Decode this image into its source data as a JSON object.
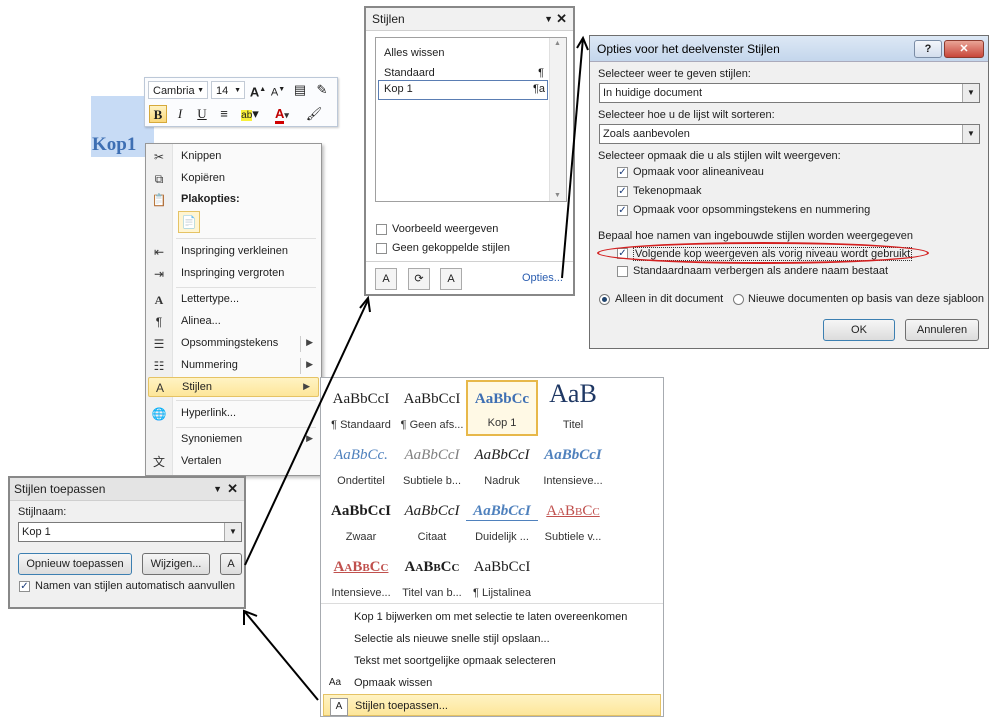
{
  "heading": {
    "text": "Kop1"
  },
  "mini_toolbar": {
    "font": "Cambria",
    "size": "14",
    "grow_label": "A",
    "shrink_label": "A",
    "bold": "B",
    "italic": "I",
    "underline": "U",
    "color_label": "A"
  },
  "context_menu": {
    "items": [
      {
        "label": "Knippen"
      },
      {
        "label": "Kopiëren"
      },
      {
        "label": "Plakopties:"
      },
      {
        "label": "Inspringing verkleinen"
      },
      {
        "label": "Inspringing vergroten"
      },
      {
        "label": "Lettertype..."
      },
      {
        "label": "Alinea..."
      },
      {
        "label": "Opsommingstekens"
      },
      {
        "label": "Nummering"
      },
      {
        "label": "Stijlen"
      },
      {
        "label": "Hyperlink..."
      },
      {
        "label": "Synoniemen"
      },
      {
        "label": "Vertalen"
      }
    ]
  },
  "styles_pane": {
    "title": "Stijlen",
    "items": [
      {
        "label": "Alles wissen",
        "mark": ""
      },
      {
        "label": "Standaard",
        "mark": "¶"
      },
      {
        "label": "Kop 1",
        "mark": "¶a"
      }
    ],
    "preview_label": "Voorbeeld weergeven",
    "linked_label": "Geen gekoppelde stijlen",
    "options_link": "Opties..."
  },
  "options_dialog": {
    "title": "Opties voor het deelvenster Stijlen",
    "help": "?",
    "close": "✕",
    "show_label": "Selecteer weer te geven stijlen:",
    "show_value": "In huidige document",
    "sort_label": "Selecteer hoe u de lijst wilt sorteren:",
    "sort_value": "Zoals aanbevolen",
    "format_label": "Selecteer opmaak die u als stijlen wilt weergeven:",
    "cb_paragraph": "Opmaak voor alineaniveau",
    "cb_font": "Tekenopmaak",
    "cb_bullets": "Opmaak voor opsommingstekens en nummering",
    "builtin_label": "Bepaal hoe namen van ingebouwde stijlen worden weergegeven",
    "cb_next_heading": "Volgende kop weergeven als vorig niveau wordt gebruikt",
    "cb_hide_std": "Standaardnaam verbergen als andere naam bestaat",
    "radio_doc": "Alleen in dit document",
    "radio_template": "Nieuwe documenten op basis van deze sjabloon",
    "ok": "OK",
    "cancel": "Annuleren"
  },
  "gallery": {
    "cells": [
      {
        "sample": "AaBbCcI",
        "name": "¶ Standaard"
      },
      {
        "sample": "AaBbCcI",
        "name": "¶ Geen afs..."
      },
      {
        "sample": "AaBbCc",
        "name": "Kop 1"
      },
      {
        "sample": "AaB",
        "name": "Titel"
      },
      {
        "sample": "AaBbCc.",
        "name": "Ondertitel"
      },
      {
        "sample": "AaBbCcI",
        "name": "Subtiele b..."
      },
      {
        "sample": "AaBbCcI",
        "name": "Nadruk"
      },
      {
        "sample": "AaBbCcI",
        "name": "Intensieve..."
      },
      {
        "sample": "AaBbCcI",
        "name": "Zwaar"
      },
      {
        "sample": "AaBbCcI",
        "name": "Citaat"
      },
      {
        "sample": "AaBbCcI",
        "name": "Duidelijk ..."
      },
      {
        "sample": "AaBbCc",
        "name": "Subtiele v..."
      },
      {
        "sample": "AaBbCc",
        "name": "Intensieve..."
      },
      {
        "sample": "AaBbCc",
        "name": "Titel van b..."
      },
      {
        "sample": "AaBbCcI",
        "name": "¶ Lijstalinea"
      }
    ],
    "commands": [
      {
        "label": "Kop 1 bijwerken om met selectie te laten overeenkomen"
      },
      {
        "label": "Selectie als nieuwe snelle stijl opslaan..."
      },
      {
        "label": "Tekst met soortgelijke opmaak selecteren"
      },
      {
        "label": "Opmaak wissen"
      },
      {
        "label": "Stijlen toepassen..."
      }
    ]
  },
  "apply_styles": {
    "title": "Stijlen toepassen",
    "name_label": "Stijlnaam:",
    "name_value": "Kop 1",
    "reapply": "Opnieuw toepassen",
    "modify": "Wijzigen...",
    "autocomplete": "Namen van stijlen automatisch aanvullen"
  },
  "colors": {
    "accent_blue": "#3e6fb3",
    "highlight_yellow": "#fde69a",
    "annotation_red": "#d32020"
  }
}
